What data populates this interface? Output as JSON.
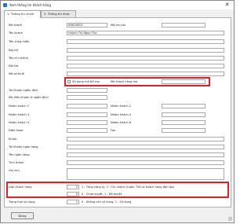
{
  "window": {
    "title": "Xem thông tin khách hàng"
  },
  "tabs": [
    {
      "label": "1. Thông tin chính"
    },
    {
      "label": "2. Thông tin khác"
    }
  ],
  "fields": {
    "ma_khach": {
      "label": "Mã khách",
      "value": "KH000001"
    },
    "ma_tra_cuu": {
      "label": "Mã tra cứu",
      "value": ""
    },
    "ten_khach": {
      "label": "Tên khách",
      "value": "Huỳnh Thị Ngọc Thư"
    },
    "ten_vung_mien": {
      "label": "Tên vùng miền",
      "value": ""
    },
    "dia_chi": {
      "label": "Địa chỉ",
      "value": ""
    },
    "ten_chi_nhanh": {
      "label": "Tên chi nhánh",
      "value": ""
    },
    "doi_tac": {
      "label": "Đối tác",
      "value": ""
    },
    "ma_so_thue": {
      "label": "Mã số thuế",
      "value": ""
    },
    "su_dung_ma_kh_me": {
      "label": "Sử dụng mã KH mẹ",
      "checked": false
    },
    "ma_khach_hang_me": {
      "label": "Mã khách hàng mẹ",
      "value": ""
    },
    "tai_khoan_ngam_dinh": {
      "label": "Tài khoản ngầm định",
      "value": ""
    },
    "ma_dieu_khoan": {
      "label": "Mã điều khoản tt ngầm định",
      "value": ""
    },
    "nhom_khach_1": {
      "label": "Nhóm khách 1",
      "value": ""
    },
    "nhom_khach_2": {
      "label": "Nhóm khách 2",
      "value": ""
    },
    "nhom_khach_3": {
      "label": "Nhóm khách 3",
      "value": ""
    },
    "nhom_khach_4": {
      "label": "Nhóm khách 4",
      "value": ""
    },
    "nhom_khach_5": {
      "label": "Nhóm khách 5",
      "value": ""
    },
    "nhom_khach_6": {
      "label": "Nhóm khách 6",
      "value": ""
    },
    "dien_thoai": {
      "label": "Điện thoại",
      "value": ""
    },
    "fax": {
      "label": "Fax",
      "value": ""
    },
    "email": {
      "label": "Email",
      "value": ""
    },
    "tai_khoan_ngan_hang": {
      "label": "Tài khoản ngân hàng",
      "value": ""
    },
    "ten_ngan_hang": {
      "label": "Tên ngân hàng",
      "value": ""
    },
    "tinh_thanh": {
      "label": "Tỉnh thành",
      "value": ""
    },
    "ghi_chu": {
      "label": "Ghi chú",
      "value": ""
    },
    "loai_khach_hang": {
      "label": "Loại khách hàng",
      "value": "2",
      "hint": "1 - Tổng công ty, 2 - Chi nhánh (hoặc: Tất cả khách hàng độc lập)"
    },
    "trang_thai_duyet": {
      "value": "0",
      "hint": "0 - Chưa duyệt, 1 - Đã duyệt"
    },
    "trang_thai_su_dung": {
      "label": "Trạng thái sử dụng",
      "value": "1",
      "hint": "0 - Không còn sử dụng, 1 - Sử dụng"
    }
  },
  "buttons": {
    "close": "Đóng"
  },
  "colors": {
    "highlight": "#e0202a",
    "accent": "#2f6fc4"
  }
}
